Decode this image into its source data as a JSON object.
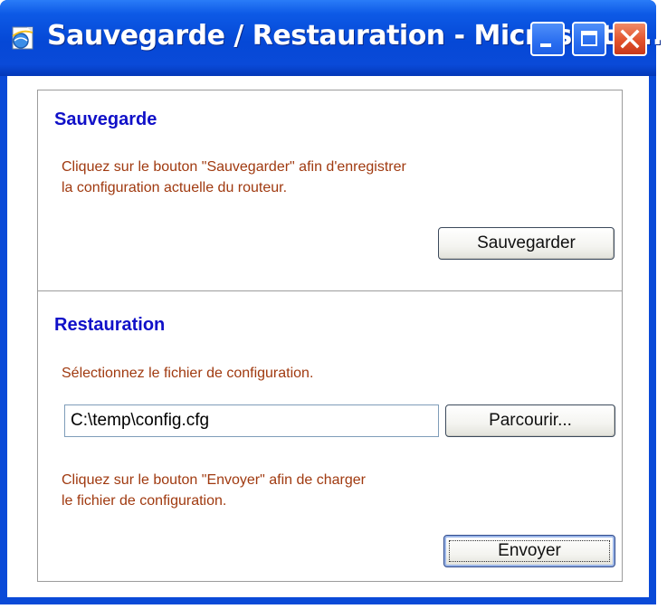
{
  "window": {
    "title": "Sauvegarde / Restauration - Microsoft I...",
    "icon": "ie-globe-icon",
    "controls": [
      "minimize-icon",
      "maximize-icon",
      "close-icon"
    ]
  },
  "backup": {
    "title": "Sauvegarde",
    "description_line1": "Cliquez sur le bouton \"Sauvegarder\" afin d'enregistrer",
    "description_line2": "la configuration actuelle du routeur.",
    "button_label": "Sauvegarder"
  },
  "restore": {
    "title": "Restauration",
    "select_prompt": "Sélectionnez le fichier de configuration.",
    "file_value": "C:\\temp\\config.cfg",
    "browse_label": "Parcourir...",
    "description_line1": "Cliquez sur le bouton \"Envoyer\" afin de charger",
    "description_line2": "le fichier de configuration.",
    "send_label": "Envoyer"
  },
  "colors": {
    "titlebar": "#0548d6",
    "section_title": "#1010c8",
    "body_text": "#a03a10",
    "close_button": "#e2522c"
  }
}
